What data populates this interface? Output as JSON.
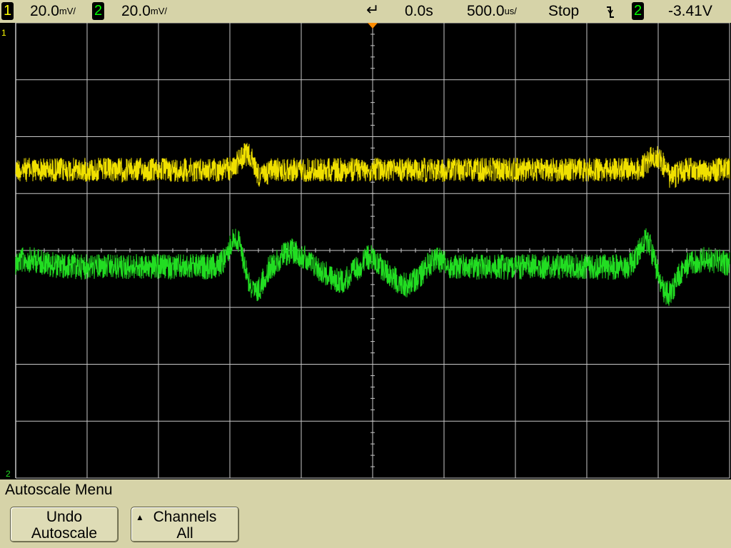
{
  "status": {
    "ch1_number": "1",
    "ch1_scale": "20.0",
    "ch1_unit": "mV/",
    "ch2_number": "2",
    "ch2_scale": "20.0",
    "ch2_unit": "mV/",
    "time_delay": "0.0s",
    "time_base": "500.0",
    "time_unit": "us/",
    "run_state": "Stop",
    "trigger_slope_icon": "falling-edge-icon",
    "trigger_channel": "2",
    "trigger_level": "-3.41V"
  },
  "screen": {
    "ch1_marker": "1",
    "ch2_marker": "2",
    "ch1_color": "#f0e000",
    "ch2_color": "#22dd22",
    "grid_color": "#c8c8c8",
    "trigger_marker_color": "#ff8c00"
  },
  "menu": {
    "title": "Autoscale Menu",
    "undo_line1": "Undo",
    "undo_line2": "Autoscale",
    "channels_line1": "Channels",
    "channels_line2": "All"
  }
}
